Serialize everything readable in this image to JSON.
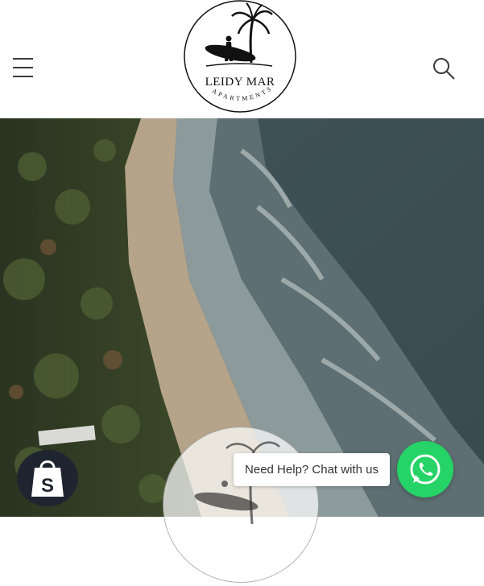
{
  "header": {
    "menu_icon": "hamburger-menu-icon",
    "search_icon": "search-icon",
    "logo_title": "LEIDY MAR",
    "logo_subtitle": "APARTMENTS"
  },
  "hero": {
    "image": "aerial beach coastline"
  },
  "chat": {
    "label": "Need Help? Chat with us",
    "icon": "whatsapp-icon"
  },
  "shopify": {
    "icon": "shopify-bag-icon"
  },
  "colors": {
    "whatsapp": "#25d366",
    "shopify_bg": "#1f2530"
  }
}
